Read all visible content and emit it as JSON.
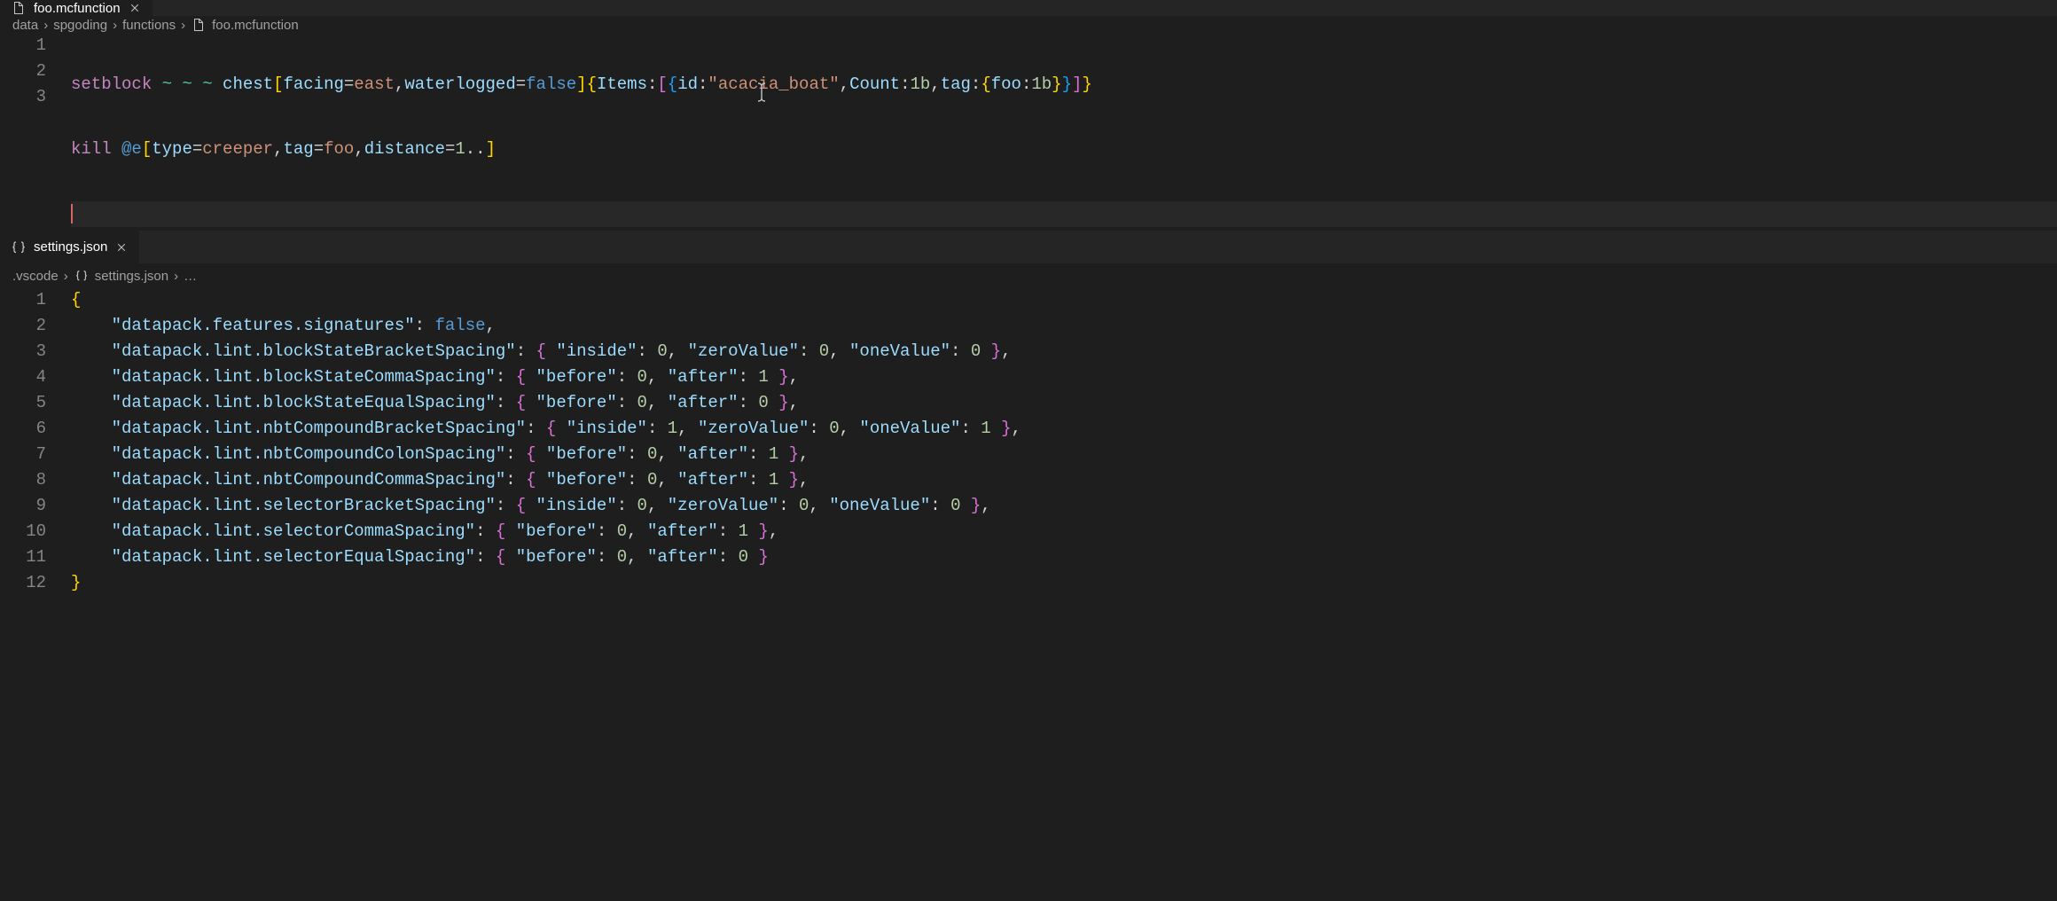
{
  "top": {
    "tab": {
      "filename": "foo.mcfunction"
    },
    "breadcrumb": [
      "data",
      "spgoding",
      "functions",
      "foo.mcfunction"
    ],
    "lines": [
      "1",
      "2",
      "3"
    ],
    "code": {
      "line1": {
        "setblock": "setblock",
        "tilde": " ~ ~ ~ ",
        "chest": "chest",
        "lb": "[",
        "facing": "facing",
        "eq1": "=",
        "east": "east",
        "comma1": ",",
        "waterlogged": "waterlogged",
        "eq2": "=",
        "false": "false",
        "rb": "]",
        "lc": "{",
        "items": "Items",
        "colon1": ":",
        "lbr": "[",
        "lc2": "{",
        "id": "id",
        "colon2": ":",
        "boat": "\"acacia_boat\"",
        "comma2": ",",
        "count": "Count",
        "colon3": ":",
        "oneb1": "1b",
        "comma3": ",",
        "tag": "tag",
        "colon4": ":",
        "lc3": "{",
        "foo": "foo",
        "colon5": ":",
        "oneb2": "1b",
        "rc3": "}",
        "rc2": "}",
        "rbr": "]",
        "rc": "}"
      },
      "line2": {
        "kill": "kill",
        "sp": " ",
        "ate": "@e",
        "lb": "[",
        "type": "type",
        "eq1": "=",
        "creeper": "creeper",
        "comma1": ",",
        "tagk": "tag",
        "eq2": "=",
        "foo": "foo",
        "comma2": ",",
        "distance": "distance",
        "eq3": "=",
        "one": "1",
        "dots": "..",
        "rb": "]"
      }
    }
  },
  "bottom": {
    "tab": {
      "filename": "settings.json"
    },
    "breadcrumb": [
      ".vscode",
      "settings.json",
      "…"
    ],
    "lines": [
      "1",
      "2",
      "3",
      "4",
      "5",
      "6",
      "7",
      "8",
      "9",
      "10",
      "11",
      "12"
    ],
    "settings": [
      {
        "key": "\"datapack.features.signatures\"",
        "raw_value": "false",
        "simple": true
      },
      {
        "key": "\"datapack.lint.blockStateBracketSpacing\"",
        "obj": [
          [
            "\"inside\"",
            "0"
          ],
          [
            "\"zeroValue\"",
            "0"
          ],
          [
            "\"oneValue\"",
            "0"
          ]
        ]
      },
      {
        "key": "\"datapack.lint.blockStateCommaSpacing\"",
        "obj": [
          [
            "\"before\"",
            "0"
          ],
          [
            "\"after\"",
            "1"
          ]
        ]
      },
      {
        "key": "\"datapack.lint.blockStateEqualSpacing\"",
        "obj": [
          [
            "\"before\"",
            "0"
          ],
          [
            "\"after\"",
            "0"
          ]
        ]
      },
      {
        "key": "\"datapack.lint.nbtCompoundBracketSpacing\"",
        "obj": [
          [
            "\"inside\"",
            "1"
          ],
          [
            "\"zeroValue\"",
            "0"
          ],
          [
            "\"oneValue\"",
            "1"
          ]
        ]
      },
      {
        "key": "\"datapack.lint.nbtCompoundColonSpacing\"",
        "obj": [
          [
            "\"before\"",
            "0"
          ],
          [
            "\"after\"",
            "1"
          ]
        ]
      },
      {
        "key": "\"datapack.lint.nbtCompoundCommaSpacing\"",
        "obj": [
          [
            "\"before\"",
            "0"
          ],
          [
            "\"after\"",
            "1"
          ]
        ]
      },
      {
        "key": "\"datapack.lint.selectorBracketSpacing\"",
        "obj": [
          [
            "\"inside\"",
            "0"
          ],
          [
            "\"zeroValue\"",
            "0"
          ],
          [
            "\"oneValue\"",
            "0"
          ]
        ]
      },
      {
        "key": "\"datapack.lint.selectorCommaSpacing\"",
        "obj": [
          [
            "\"before\"",
            "0"
          ],
          [
            "\"after\"",
            "1"
          ]
        ]
      },
      {
        "key": "\"datapack.lint.selectorEqualSpacing\"",
        "obj": [
          [
            "\"before\"",
            "0"
          ],
          [
            "\"after\"",
            "0"
          ]
        ],
        "last": true
      }
    ],
    "braces": {
      "open": "{",
      "close": "}"
    }
  }
}
